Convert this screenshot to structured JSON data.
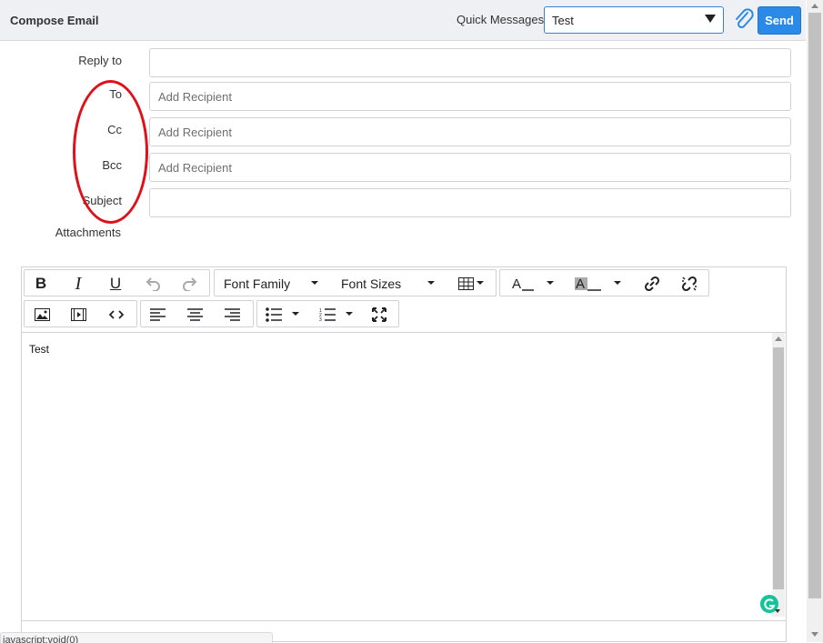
{
  "header": {
    "title": "Compose Email",
    "quick_messages_label": "Quick Messages",
    "quick_messages_value": "Test",
    "send_label": "Send",
    "accent_color": "#2b8ae8"
  },
  "form": {
    "reply_to_label": "Reply to",
    "reply_to_value": "",
    "to_label": "To",
    "to_placeholder": "Add Recipient",
    "cc_label": "Cc",
    "cc_placeholder": "Add Recipient",
    "bcc_label": "Bcc",
    "bcc_placeholder": "Add Recipient",
    "subject_label": "Subject",
    "subject_value": "",
    "attachments_label": "Attachments"
  },
  "editor": {
    "font_family_label": "Font Family",
    "font_sizes_label": "Font Sizes",
    "body_text": "Test",
    "toolbar_icons": [
      "bold-icon",
      "italic-icon",
      "underline-icon",
      "undo-icon",
      "redo-icon",
      "table-icon",
      "text-color-icon",
      "background-color-icon",
      "link-icon",
      "unlink-icon",
      "image-icon",
      "video-icon",
      "source-code-icon",
      "align-left-icon",
      "align-center-icon",
      "align-right-icon",
      "bullet-list-icon",
      "numbered-list-icon",
      "fullscreen-icon"
    ]
  },
  "status": {
    "url_text": "javascript:void(0)"
  },
  "annotation": {
    "highlight_color": "#e0101a"
  }
}
